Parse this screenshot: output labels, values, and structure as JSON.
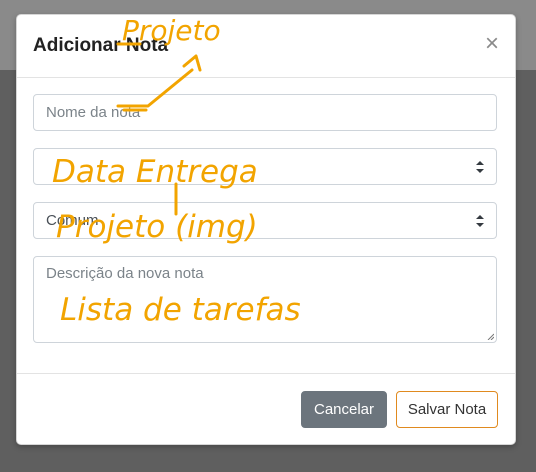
{
  "modal": {
    "title": "Adicionar Nota",
    "close_glyph": "×",
    "name_placeholder": "Nome da nota",
    "select1_value": "",
    "select2_value": "Comum",
    "description_placeholder": "Descrição da nova nota",
    "cancel_label": "Cancelar",
    "save_label": "Salvar Nota"
  },
  "annotations": {
    "projeto": "Projeto",
    "data_entrega": "Data Entrega",
    "projeto_img": "Projeto (img)",
    "lista_tarefas": "Lista de tarefas"
  },
  "colors": {
    "annotation": "#f2a400",
    "cancel_bg": "#6c757d",
    "save_border": "#e08a1f"
  }
}
